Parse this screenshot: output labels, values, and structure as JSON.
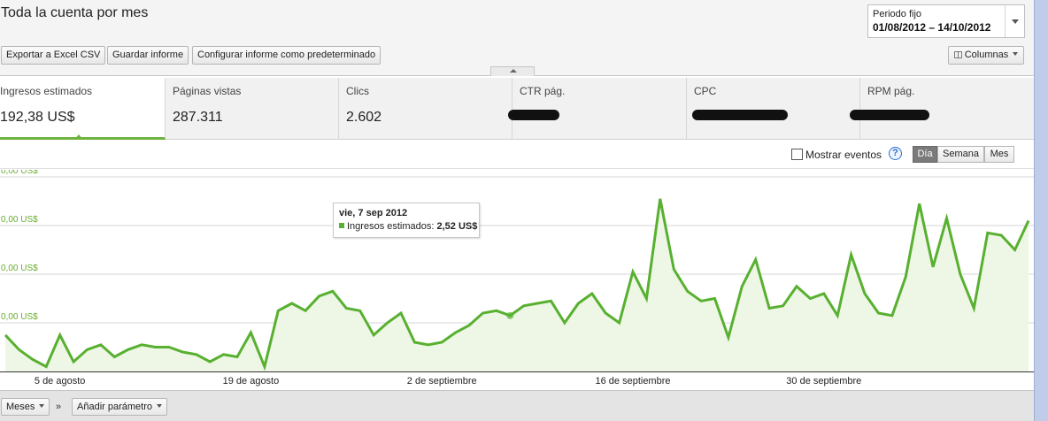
{
  "header": {
    "title": "Toda la cuenta por mes",
    "date_label": "Periodo fijo",
    "date_range": "01/08/2012 – 14/10/2012"
  },
  "toolbar": {
    "export_label": "Exportar a Excel CSV",
    "save_label": "Guardar informe",
    "config_label": "Configurar informe como predeterminado",
    "columns_label": "Columnas"
  },
  "metrics": [
    {
      "label": "Ingresos estimados",
      "value": "192,38 US$"
    },
    {
      "label": "Páginas vistas",
      "value": "287.311"
    },
    {
      "label": "Clics",
      "value": "2.602"
    },
    {
      "label": "CTR pág.",
      "value": ""
    },
    {
      "label": "CPC",
      "value": ""
    },
    {
      "label": "RPM pág.",
      "value": ""
    }
  ],
  "controls": {
    "show_events": "Mostrar eventos",
    "help": "?",
    "day": "Día",
    "week": "Semana",
    "month": "Mes"
  },
  "tooltip": {
    "date": "vie, 7 sep 2012",
    "series": "Ingresos estimados:",
    "value": "2,52 US$"
  },
  "bottom": {
    "months_label": "Meses",
    "separator": "»",
    "add_param_label": "Añadir parámetro"
  },
  "colors": {
    "line": "#58b030",
    "fill": "#eef7e6",
    "grid": "#d4d4d4",
    "axis_label": "#6aab2e"
  },
  "chart_data": {
    "type": "area",
    "series": [
      {
        "name": "Ingresos estimados",
        "values": [
          1.5,
          0.9,
          0.5,
          0.2,
          1.5,
          0.4,
          0.9,
          1.1,
          0.6,
          0.9,
          1.1,
          1.0,
          1.0,
          0.8,
          0.7,
          0.4,
          0.7,
          0.6,
          1.6,
          0.2,
          2.5,
          2.8,
          2.5,
          3.1,
          3.3,
          2.6,
          2.5,
          1.5,
          2.0,
          2.4,
          1.2,
          1.1,
          1.2,
          1.6,
          1.9,
          2.4,
          2.5,
          2.3,
          2.7,
          2.8,
          2.9,
          2.0,
          2.8,
          3.2,
          2.4,
          2.0,
          4.1,
          3.0,
          7.1,
          4.2,
          3.3,
          2.9,
          3.0,
          1.4,
          3.5,
          4.6,
          2.6,
          2.7,
          3.5,
          3.0,
          3.2,
          2.3,
          4.8,
          3.2,
          2.4,
          2.3,
          3.9,
          6.9,
          4.3,
          6.3,
          4.0,
          2.6,
          5.7,
          5.6,
          5.0,
          6.2
        ]
      }
    ],
    "x_ticks": [
      "5 de agosto",
      "19 de agosto",
      "2 de septiembre",
      "16 de septiembre",
      "30 de septiembre"
    ],
    "y_ticks": [
      "0,00 US$",
      "0,00 US$",
      "0,00 US$",
      "0,00 US$"
    ],
    "ylim": [
      0,
      8
    ],
    "grid": true,
    "highlight_index": 37
  }
}
